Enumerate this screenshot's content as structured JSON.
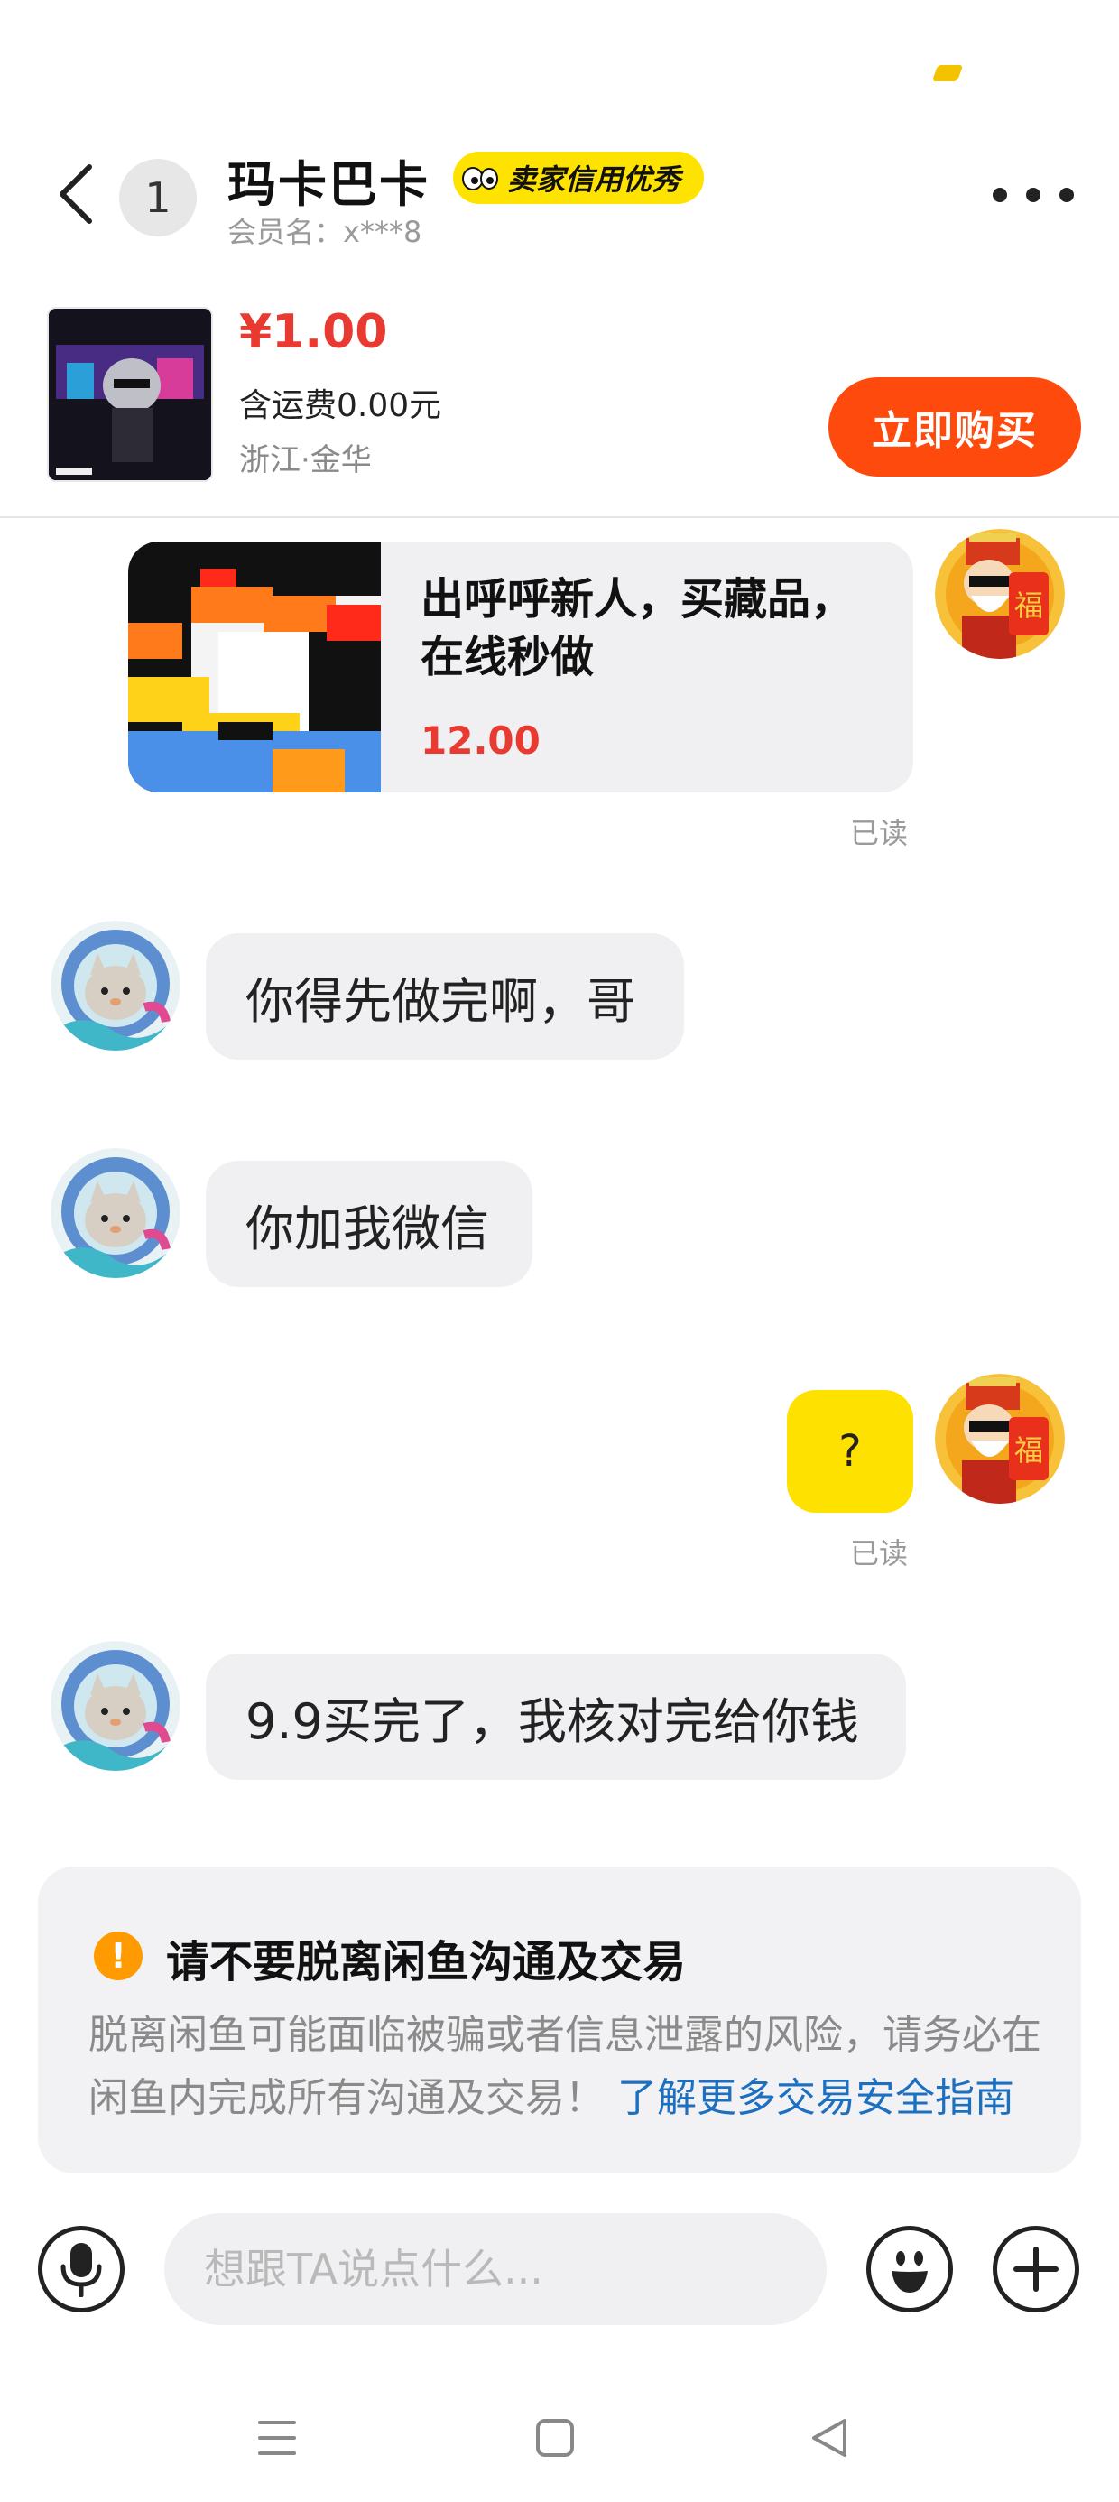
{
  "header": {
    "unread_count": "1",
    "seller_name": "玛卡巴卡",
    "credit_badge": "卖家信用优秀",
    "member_id": "会员名：x***8"
  },
  "product": {
    "price": "¥1.00",
    "shipping": "含运费0.00元",
    "location": "浙江·金华",
    "buy_label": "立即购买"
  },
  "messages": {
    "card_title": "出呼呼新人，买藏品，在线秒做",
    "card_price": "12.00",
    "card_read": "已读",
    "m1": "你得先做完啊，哥",
    "m2": "你加我微信",
    "m3": "?",
    "m3_read": "已读",
    "m4": "9.9买完了，我核对完给你钱"
  },
  "warning": {
    "title": "请不要脱离闲鱼沟通及交易",
    "body": "脱离闲鱼可能面临被骗或者信息泄露的风险，请务必在闲鱼内完成所有沟通及交易！",
    "link": "了解更多交易安全指南"
  },
  "input": {
    "placeholder": "想跟TA说点什么..."
  },
  "colors": {
    "accent_orange": "#ff4a0e",
    "price_red": "#e83a31",
    "badge_yellow": "#ffe300",
    "link_blue": "#1d6fc0"
  }
}
